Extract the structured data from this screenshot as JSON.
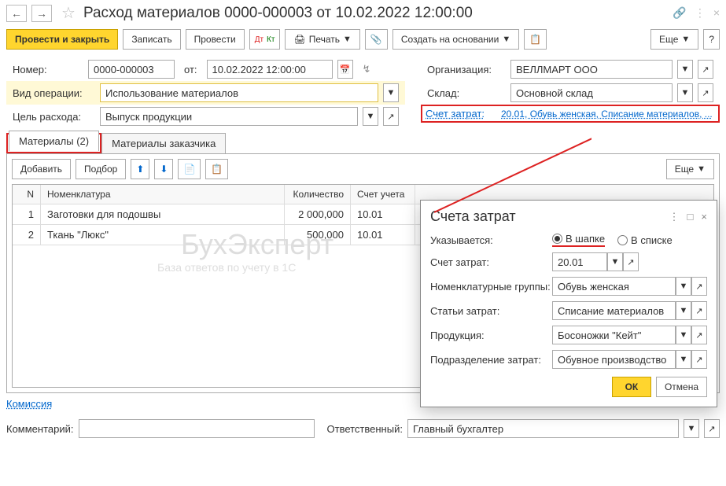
{
  "title": "Расход материалов 0000-000003 от 10.02.2022 12:00:00",
  "toolbar": {
    "post_close": "Провести и закрыть",
    "save": "Записать",
    "post": "Провести",
    "print": "Печать",
    "create_based": "Создать на основании",
    "more": "Еще"
  },
  "fields": {
    "number_label": "Номер:",
    "number_value": "0000-000003",
    "from_label": "от:",
    "date_value": "10.02.2022 12:00:00",
    "org_label": "Организация:",
    "org_value": "ВЕЛЛМАРТ ООО",
    "op_type_label": "Вид операции:",
    "op_type_value": "Использование материалов",
    "warehouse_label": "Склад:",
    "warehouse_value": "Основной склад",
    "purpose_label": "Цель расхода:",
    "purpose_value": "Выпуск продукции",
    "cost_acc_label": "Счет затрат:",
    "cost_acc_value": "20.01, Обувь женская, Списание материалов, ..."
  },
  "tabs": {
    "materials": "Материалы (2)",
    "customer_materials": "Материалы заказчика"
  },
  "grid_toolbar": {
    "add": "Добавить",
    "pick": "Подбор",
    "more": "Еще"
  },
  "grid": {
    "head": {
      "n": "N",
      "name": "Номенклатура",
      "qty": "Количество",
      "acc": "Счет учета"
    },
    "rows": [
      {
        "n": "1",
        "name": "Заготовки для подошвы",
        "qty": "2 000,000",
        "acc": "10.01"
      },
      {
        "n": "2",
        "name": "Ткань \"Люкс\"",
        "qty": "500,000",
        "acc": "10.01"
      }
    ]
  },
  "popup": {
    "title": "Счета затрат",
    "specified_label": "Указывается:",
    "radio_header": "В шапке",
    "radio_list": "В списке",
    "acc_label": "Счет затрат:",
    "acc_value": "20.01",
    "nomgroup_label": "Номенклатурные группы:",
    "nomgroup_value": "Обувь женская",
    "article_label": "Статьи затрат:",
    "article_value": "Списание материалов",
    "product_label": "Продукция:",
    "product_value": "Босоножки \"Кейт\"",
    "division_label": "Подразделение затрат:",
    "division_value": "Обувное производство",
    "ok": "ОК",
    "cancel": "Отмена"
  },
  "footer": {
    "commission": "Комиссия",
    "comment_label": "Комментарий:",
    "responsible_label": "Ответственный:",
    "responsible_value": "Главный бухгалтер"
  }
}
